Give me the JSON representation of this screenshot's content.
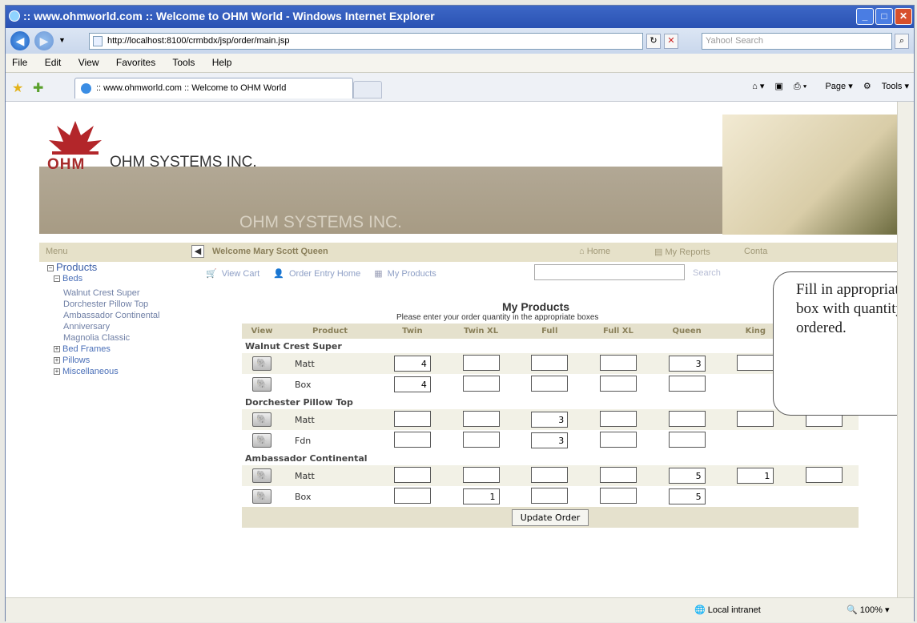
{
  "window": {
    "title": ":: www.ohmworld.com :: Welcome to OHM World - Windows Internet Explorer"
  },
  "address": {
    "url": "http://localhost:8100/crmbdx/jsp/order/main.jsp",
    "search_placeholder": "Yahoo! Search"
  },
  "menubar": [
    "File",
    "Edit",
    "View",
    "Favorites",
    "Tools",
    "Help"
  ],
  "tab": {
    "label": ":: www.ohmworld.com :: Welcome to OHM World"
  },
  "commandbar": {
    "page": "Page",
    "tools": "Tools"
  },
  "banner": {
    "logo": "OHM",
    "company": "OHM SYSTEMS INC.",
    "company_shadow": "OHM SYSTEMS INC."
  },
  "nav": {
    "menu": "Menu",
    "welcome": "Welcome Mary Scott Queen",
    "home": "Home",
    "reports": "My Reports",
    "contact": "Conta"
  },
  "sidebar": {
    "products": "Products",
    "beds": "Beds",
    "bed_items": [
      "Walnut Crest Super",
      "Dorchester Pillow Top",
      "Ambassador Continental",
      "Anniversary",
      "Magnolia Classic"
    ],
    "bed_frames": "Bed Frames",
    "pillows": "Pillows",
    "misc": "Miscellaneous"
  },
  "links": {
    "view_cart": "View Cart",
    "order_home": "Order Entry Home",
    "my_products": "My Products",
    "search": "Search"
  },
  "page": {
    "title": "My Products",
    "subtitle": "Please enter your order quantity in the appropriate boxes"
  },
  "columns": [
    "View",
    "Product",
    "Twin",
    "Twin XL",
    "Full",
    "Full XL",
    "Queen",
    "King"
  ],
  "groups": [
    {
      "name": "Walnut Crest Super",
      "rows": [
        {
          "product": "Matt",
          "q": [
            "4",
            "",
            "",
            "",
            "3",
            "",
            ""
          ],
          "n": 7
        },
        {
          "product": "Box",
          "q": [
            "4",
            "",
            "",
            "",
            ""
          ],
          "n": 5
        }
      ]
    },
    {
      "name": "Dorchester Pillow Top",
      "rows": [
        {
          "product": "Matt",
          "q": [
            "",
            "",
            "3",
            "",
            "",
            "",
            ""
          ],
          "n": 7
        },
        {
          "product": "Fdn",
          "q": [
            "",
            "",
            "3",
            "",
            ""
          ],
          "n": 5
        }
      ]
    },
    {
      "name": "Ambassador Continental",
      "rows": [
        {
          "product": "Matt",
          "q": [
            "",
            "",
            "",
            "",
            "5",
            "1",
            ""
          ],
          "n": 7
        },
        {
          "product": "Box",
          "q": [
            "",
            "1",
            "",
            "",
            "5"
          ],
          "n": 5
        }
      ]
    }
  ],
  "update_button": "Update Order",
  "callout": {
    "text": "Fill in appropriate box with quantity ordered."
  },
  "status": {
    "zone": "Local intranet",
    "zoom": "100%"
  }
}
